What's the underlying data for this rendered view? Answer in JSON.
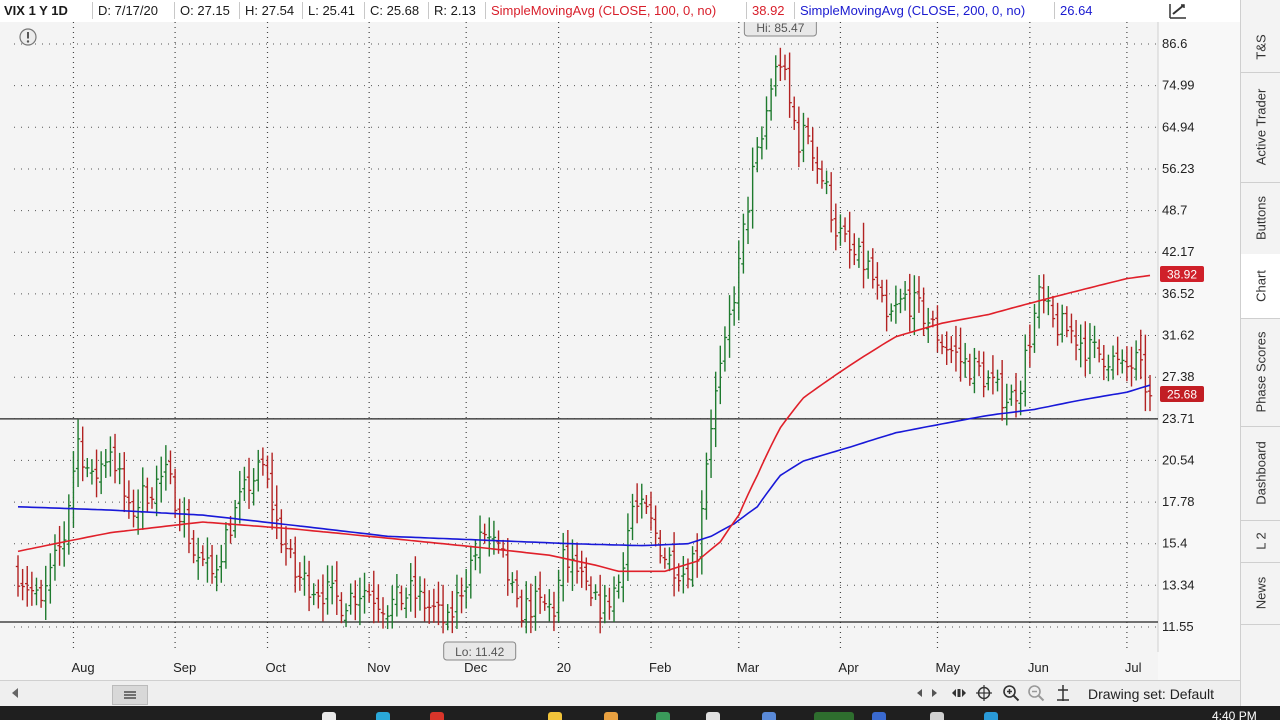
{
  "header": {
    "symbol": "VIX 1 Y 1D",
    "date": "D: 7/17/20",
    "open": "O: 27.15",
    "high": "H: 27.54",
    "low": "L: 25.41",
    "close": "C: 25.68",
    "range": "R: 2.13",
    "sma100_label": "SimpleMovingAvg (CLOSE, 100, 0, no)",
    "sma100_value": "38.92",
    "sma200_label": "SimpleMovingAvg (CLOSE, 200, 0, no)",
    "sma200_value": "26.64"
  },
  "sidebar": {
    "tabs": [
      {
        "label": "T&S",
        "active": false
      },
      {
        "label": "Active Trader",
        "active": false
      },
      {
        "label": "Buttons",
        "active": false
      },
      {
        "label": "Chart",
        "active": true
      },
      {
        "label": "Phase Scores",
        "active": false
      },
      {
        "label": "Dashboard",
        "active": false
      },
      {
        "label": "L 2",
        "active": false
      },
      {
        "label": "News",
        "active": false
      }
    ]
  },
  "bottombar": {
    "drawing_set": "Drawing set: Default"
  },
  "taskbar": {
    "clock": "4:40 PM"
  },
  "colors": {
    "up": "#1e7a2e",
    "down": "#b22222",
    "sma100": "#e0202a",
    "sma200": "#1818d8",
    "background": "#f4f4f4"
  },
  "chart_data": {
    "type": "candlestick",
    "symbol": "VIX",
    "y_scale": "log",
    "y_ticks": [
      "86.6",
      "74.99",
      "64.94",
      "56.23",
      "48.7",
      "42.17",
      "36.52",
      "31.62",
      "27.38",
      "23.71",
      "20.54",
      "17.78",
      "15.4",
      "13.34",
      "11.55"
    ],
    "x_labels": [
      {
        "label": "Aug",
        "index": 12
      },
      {
        "label": "Sep",
        "index": 34
      },
      {
        "label": "Oct",
        "index": 54
      },
      {
        "label": "Nov",
        "index": 76
      },
      {
        "label": "Dec",
        "index": 97
      },
      {
        "label": "20",
        "index": 117
      },
      {
        "label": "Feb",
        "index": 137
      },
      {
        "label": "Mar",
        "index": 156
      },
      {
        "label": "Apr",
        "index": 178
      },
      {
        "label": "May",
        "index": 199
      },
      {
        "label": "Jun",
        "index": 219
      },
      {
        "label": "Jul",
        "index": 240
      }
    ],
    "hi_label": "Hi: 85.47",
    "lo_label": "Lo: 11.42",
    "hi_value": 85.47,
    "lo_value": 11.42,
    "horizontal_lines": [
      23.71,
      11.75
    ],
    "sma100_last": {
      "label": "38.92",
      "value": 38.92
    },
    "last_price": {
      "label": "25.68",
      "value": 25.68
    },
    "close_anchors": [
      [
        0,
        14.0
      ],
      [
        5,
        12.4
      ],
      [
        10,
        15.8
      ],
      [
        13,
        22.0
      ],
      [
        16,
        19.0
      ],
      [
        20,
        21.5
      ],
      [
        24,
        17.0
      ],
      [
        28,
        18.5
      ],
      [
        32,
        19.5
      ],
      [
        35,
        17.5
      ],
      [
        38,
        15.0
      ],
      [
        42,
        13.8
      ],
      [
        46,
        16.5
      ],
      [
        50,
        19.0
      ],
      [
        53,
        20.0
      ],
      [
        56,
        16.5
      ],
      [
        60,
        13.8
      ],
      [
        65,
        13.2
      ],
      [
        70,
        12.6
      ],
      [
        75,
        13.2
      ],
      [
        80,
        12.4
      ],
      [
        85,
        13.0
      ],
      [
        90,
        12.2
      ],
      [
        93,
        11.6
      ],
      [
        97,
        13.8
      ],
      [
        101,
        16.0
      ],
      [
        105,
        14.5
      ],
      [
        108,
        12.2
      ],
      [
        112,
        12.5
      ],
      [
        116,
        12.3
      ],
      [
        118,
        14.5
      ],
      [
        121,
        14.0
      ],
      [
        124,
        12.5
      ],
      [
        127,
        12.4
      ],
      [
        130,
        13.5
      ],
      [
        133,
        17.5
      ],
      [
        136,
        17.0
      ],
      [
        140,
        14.8
      ],
      [
        144,
        14.0
      ],
      [
        147,
        15.0
      ],
      [
        150,
        23.5
      ],
      [
        153,
        30.0
      ],
      [
        156,
        40.0
      ],
      [
        159,
        55.0
      ],
      [
        161,
        62.0
      ],
      [
        163,
        75.0
      ],
      [
        165,
        82.0
      ],
      [
        167,
        70.0
      ],
      [
        169,
        62.0
      ],
      [
        171,
        64.0
      ],
      [
        173,
        57.0
      ],
      [
        175,
        52.0
      ],
      [
        177,
        46.0
      ],
      [
        180,
        42.0
      ],
      [
        184,
        40.0
      ],
      [
        188,
        33.0
      ],
      [
        192,
        36.0
      ],
      [
        196,
        34.0
      ],
      [
        200,
        31.0
      ],
      [
        204,
        29.0
      ],
      [
        208,
        28.0
      ],
      [
        212,
        26.0
      ],
      [
        215,
        25.5
      ],
      [
        217,
        27.0
      ],
      [
        219,
        31.5
      ],
      [
        221,
        36.0
      ],
      [
        224,
        33.0
      ],
      [
        228,
        32.0
      ],
      [
        232,
        30.0
      ],
      [
        236,
        29.5
      ],
      [
        239,
        28.0
      ],
      [
        242,
        28.8
      ],
      [
        245,
        25.68
      ]
    ],
    "sma100_anchors": [
      [
        0,
        15.0
      ],
      [
        20,
        16.0
      ],
      [
        40,
        16.6
      ],
      [
        60,
        16.2
      ],
      [
        80,
        15.7
      ],
      [
        100,
        15.2
      ],
      [
        115,
        14.8
      ],
      [
        125,
        14.3
      ],
      [
        130,
        14.0
      ],
      [
        140,
        14.0
      ],
      [
        147,
        14.5
      ],
      [
        152,
        15.5
      ],
      [
        156,
        17.0
      ],
      [
        160,
        19.5
      ],
      [
        165,
        23.0
      ],
      [
        170,
        25.5
      ],
      [
        180,
        28.5
      ],
      [
        190,
        31.5
      ],
      [
        200,
        33.0
      ],
      [
        210,
        34.0
      ],
      [
        220,
        35.5
      ],
      [
        230,
        37.0
      ],
      [
        240,
        38.5
      ],
      [
        245,
        38.92
      ]
    ],
    "sma200_anchors": [
      [
        0,
        17.5
      ],
      [
        20,
        17.3
      ],
      [
        40,
        17.0
      ],
      [
        60,
        16.4
      ],
      [
        80,
        15.8
      ],
      [
        100,
        15.6
      ],
      [
        120,
        15.4
      ],
      [
        135,
        15.3
      ],
      [
        145,
        15.4
      ],
      [
        150,
        15.8
      ],
      [
        155,
        16.5
      ],
      [
        160,
        17.5
      ],
      [
        165,
        19.5
      ],
      [
        170,
        20.5
      ],
      [
        180,
        21.5
      ],
      [
        190,
        22.6
      ],
      [
        200,
        23.3
      ],
      [
        210,
        24.0
      ],
      [
        220,
        24.5
      ],
      [
        230,
        25.3
      ],
      [
        240,
        26.0
      ],
      [
        245,
        26.64
      ]
    ]
  }
}
